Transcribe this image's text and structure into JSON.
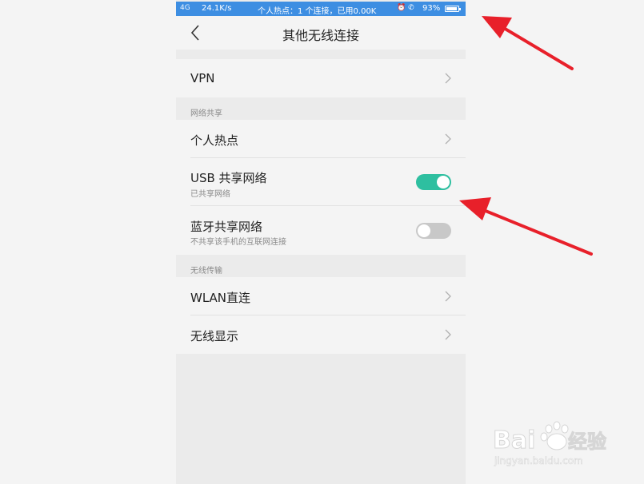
{
  "status_bar": {
    "signal": "4G",
    "speed": "24.1K/s",
    "center_text": "个人热点：1 个连接，已用0.00K",
    "icons": [
      "alarm-icon",
      "phone-icon"
    ],
    "battery_percent": "93%",
    "battery_level": 0.93,
    "background": "#3d8ee2"
  },
  "header": {
    "title": "其他无线连接"
  },
  "vpn": {
    "label": "VPN"
  },
  "section_share": {
    "label": "网络共享",
    "hotspot": {
      "label": "个人热点"
    },
    "usb": {
      "label": "USB 共享网络",
      "sub": "已共享网络",
      "enabled": true
    },
    "bluetooth": {
      "label": "蓝牙共享网络",
      "sub": "不共享该手机的互联网连接",
      "enabled": false
    }
  },
  "section_wireless": {
    "label": "无线传输",
    "wlan_direct": {
      "label": "WLAN直连"
    },
    "wireless_display": {
      "label": "无线显示"
    }
  },
  "colors": {
    "toggle_on": "#2ebfa0",
    "annotation_arrow": "#e8202a"
  },
  "watermark": {
    "brand": "Bai",
    "brand_suffix": "经验",
    "url": "jingyan.baidu.com"
  }
}
